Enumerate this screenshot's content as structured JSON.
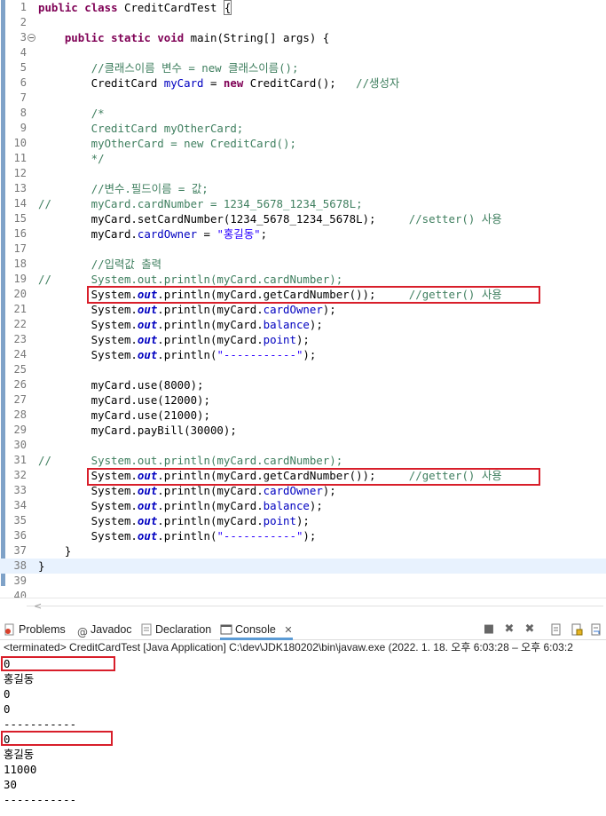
{
  "editor": {
    "lines": [
      {
        "n": "1",
        "html": "<span class=\"kw\">public</span> <span class=\"kw\">class</span> CreditCardTest <span class=\"brace-mark\">{</span>"
      },
      {
        "n": "2",
        "html": ""
      },
      {
        "n": "3",
        "html": "    <span class=\"kw\">public</span> <span class=\"kw\">static</span> <span class=\"kw\">void</span> main(String[] args) {"
      },
      {
        "n": "4",
        "html": ""
      },
      {
        "n": "5",
        "html": "        <span class=\"cm\">//클래스이름 변수 = new 클래스이름();</span>"
      },
      {
        "n": "6",
        "html": "        CreditCard <span class=\"fld\">myCard</span> = <span class=\"kw\">new</span> CreditCard();   <span class=\"cm\">//생성자</span>"
      },
      {
        "n": "7",
        "html": ""
      },
      {
        "n": "8",
        "html": "        <span class=\"cm\">/*</span>"
      },
      {
        "n": "9",
        "html": "<span class=\"cm\">        CreditCard myOtherCard;</span>"
      },
      {
        "n": "10",
        "html": "<span class=\"cm\">        myOtherCard = new CreditCard();</span>"
      },
      {
        "n": "11",
        "html": "<span class=\"cm\">        */</span>"
      },
      {
        "n": "12",
        "html": ""
      },
      {
        "n": "13",
        "html": "        <span class=\"cm\">//변수.필드이름 = 값;</span>"
      },
      {
        "n": "14",
        "html": "<span class=\"cm\">//      myCard.cardNumber = 1234_5678_1234_5678L;</span>"
      },
      {
        "n": "15",
        "html": "        myCard.setCardNumber(1234_5678_1234_5678L);     <span class=\"cm\">//setter() 사용</span>"
      },
      {
        "n": "16",
        "html": "        myCard.<span class=\"fld\">cardOwner</span> = <span class=\"str\">\"홍길동\"</span>;"
      },
      {
        "n": "17",
        "html": ""
      },
      {
        "n": "18",
        "html": "        <span class=\"cm\">//입력값 출력</span>"
      },
      {
        "n": "19",
        "html": "<span class=\"cm\">//      System.out.println(myCard.cardNumber);</span>"
      },
      {
        "n": "20",
        "html": "        System.<span class=\"st\">out</span>.println(myCard.getCardNumber());     <span class=\"cm\">//getter() 사용</span>"
      },
      {
        "n": "21",
        "html": "        System.<span class=\"st\">out</span>.println(myCard.<span class=\"fld\">cardOwner</span>);"
      },
      {
        "n": "22",
        "html": "        System.<span class=\"st\">out</span>.println(myCard.<span class=\"fld\">balance</span>);"
      },
      {
        "n": "23",
        "html": "        System.<span class=\"st\">out</span>.println(myCard.<span class=\"fld\">point</span>);"
      },
      {
        "n": "24",
        "html": "        System.<span class=\"st\">out</span>.println(<span class=\"str\">\"-----------\"</span>);"
      },
      {
        "n": "25",
        "html": ""
      },
      {
        "n": "26",
        "html": "        myCard.use(8000);"
      },
      {
        "n": "27",
        "html": "        myCard.use(12000);"
      },
      {
        "n": "28",
        "html": "        myCard.use(21000);"
      },
      {
        "n": "29",
        "html": "        myCard.payBill(30000);"
      },
      {
        "n": "30",
        "html": ""
      },
      {
        "n": "31",
        "html": "<span class=\"cm\">//      System.out.println(myCard.cardNumber);</span>"
      },
      {
        "n": "32",
        "html": "        System.<span class=\"st\">out</span>.println(myCard.getCardNumber());     <span class=\"cm\">//getter() 사용</span>"
      },
      {
        "n": "33",
        "html": "        System.<span class=\"st\">out</span>.println(myCard.<span class=\"fld\">cardOwner</span>);"
      },
      {
        "n": "34",
        "html": "        System.<span class=\"st\">out</span>.println(myCard.<span class=\"fld\">balance</span>);"
      },
      {
        "n": "35",
        "html": "        System.<span class=\"st\">out</span>.println(myCard.<span class=\"fld\">point</span>);"
      },
      {
        "n": "36",
        "html": "        System.<span class=\"st\">out</span>.println(<span class=\"str\">\"-----------\"</span>);"
      },
      {
        "n": "37",
        "html": "    }"
      },
      {
        "n": "38",
        "html": "}"
      },
      {
        "n": "39",
        "html": ""
      },
      {
        "n": "40",
        "html": ""
      }
    ]
  },
  "tabs": {
    "problems": "Problems",
    "javadoc": "Javadoc",
    "declaration": "Declaration",
    "console": "Console"
  },
  "console": {
    "terminated": "<terminated> CreditCardTest [Java Application] C:\\dev\\JDK180202\\bin\\javaw.exe  (2022. 1. 18. 오후 6:03:28 – 오후 6:03:2",
    "output": [
      "0",
      "홍길동",
      "0",
      "0",
      "-----------",
      "0",
      "홍길동",
      "11000",
      "30",
      "-----------"
    ]
  }
}
